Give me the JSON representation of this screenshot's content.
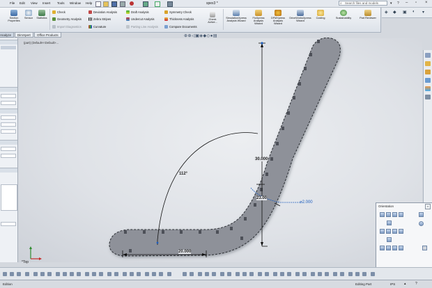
{
  "menubar": {
    "items": [
      "File",
      "Edit",
      "View",
      "Insert",
      "Tools",
      "Window",
      "Help"
    ],
    "doc_title": "spex3 *",
    "search_placeholder": "Search files and models"
  },
  "ribbon": {
    "left_buttons": [
      {
        "label": "Section Properties",
        "icon": "section-properties-icon"
      },
      {
        "label": "Sensor",
        "icon": "sensor-icon"
      },
      {
        "label": "Statistics",
        "icon": "statistics-icon"
      }
    ],
    "col1": [
      {
        "label": "Check",
        "icon": "check-icon",
        "disabled": false
      },
      {
        "label": "Geometry Analysis",
        "icon": "geometry-analysis-icon",
        "disabled": false
      },
      {
        "label": "Import Diagnostics",
        "icon": "import-diagnostics-icon",
        "disabled": true
      }
    ],
    "col2": [
      {
        "label": "Deviation Analysis",
        "icon": "deviation-analysis-icon",
        "disabled": false
      },
      {
        "label": "Zebra Stripes",
        "icon": "zebra-stripes-icon",
        "disabled": false
      },
      {
        "label": "Curvature",
        "icon": "curvature-icon",
        "disabled": false
      }
    ],
    "col3": [
      {
        "label": "Draft Analysis",
        "icon": "draft-analysis-icon",
        "disabled": false
      },
      {
        "label": "Undercut Analysis",
        "icon": "undercut-analysis-icon",
        "disabled": false
      },
      {
        "label": "Parting Line Analysis",
        "icon": "parting-line-analysis-icon",
        "disabled": true
      }
    ],
    "col4": [
      {
        "label": "Symmetry Check",
        "icon": "symmetry-check-icon",
        "disabled": false
      },
      {
        "label": "Thickness Analysis",
        "icon": "thickness-analysis-icon",
        "disabled": false
      },
      {
        "label": "Compare Documents",
        "icon": "compare-documents-icon",
        "disabled": false
      }
    ],
    "check_active": "Check Active...",
    "right_buttons": [
      {
        "label": "SimulationXpress Analysis Wizard",
        "icon": "simulationxpress-icon"
      },
      {
        "label": "FloXpress Analysis Wizard",
        "icon": "floxpress-icon"
      },
      {
        "label": "DFMXpress Analysis Wizard",
        "icon": "dfmxpress-icon"
      },
      {
        "label": "DriveWorksXpress Wizard",
        "icon": "driveworksxpress-icon"
      },
      {
        "label": "Costing",
        "icon": "costing-icon"
      },
      {
        "label": "Sustainability",
        "icon": "sustainability-icon"
      },
      {
        "label": "Part Reviewer",
        "icon": "part-reviewer-icon"
      }
    ]
  },
  "tabs": [
    "Analyze",
    "DimXpert",
    "Office Products"
  ],
  "tree": {
    "root": "(part) (Default<<Default>..."
  },
  "sketch": {
    "dims": {
      "angle": "112°",
      "vertical_long": "30.000",
      "vertical_short": "23.00",
      "radial": "⌀2.000",
      "horizontal": "20.000"
    },
    "view_label": "*Top"
  },
  "orientation": {
    "title": "Orientation"
  },
  "status": {
    "edition": "Edition",
    "mode": "Editing Part",
    "units": "IPS"
  },
  "colors": {
    "part_fill": "#8e9199",
    "dim_line": "#111111",
    "accent": "#1f5fbf"
  }
}
